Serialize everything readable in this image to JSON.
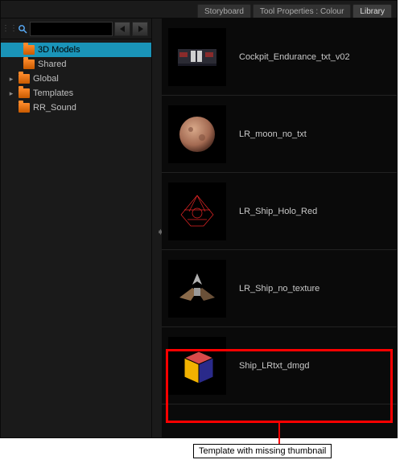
{
  "tabs": {
    "storyboard": "Storyboard",
    "tool_properties": "Tool Properties : Colour",
    "library": "Library",
    "active": "library"
  },
  "toolbar": {
    "search_value": "",
    "search_placeholder": ""
  },
  "tree": {
    "items": [
      {
        "label": "3D Models",
        "selected": true,
        "expandable": false,
        "indent": true
      },
      {
        "label": "Shared",
        "selected": false,
        "expandable": false,
        "indent": true
      },
      {
        "label": "Global",
        "selected": false,
        "expandable": true,
        "indent": false
      },
      {
        "label": "Templates",
        "selected": false,
        "expandable": true,
        "indent": false
      },
      {
        "label": "RR_Sound",
        "selected": false,
        "expandable": false,
        "indent": false
      }
    ]
  },
  "items": [
    {
      "name": "Cockpit_Endurance_txt_v02",
      "thumb": "cockpit"
    },
    {
      "name": "LR_moon_no_txt",
      "thumb": "moon"
    },
    {
      "name": "LR_Ship_Holo_Red",
      "thumb": "holo"
    },
    {
      "name": "LR_Ship_no_texture",
      "thumb": "ship"
    },
    {
      "name": "Ship_LRtxt_dmgd",
      "thumb": "cube"
    }
  ],
  "annotation": {
    "label": "Template with missing thumbnail"
  },
  "colors": {
    "selection": "#1a94b8",
    "highlight": "#ff0000"
  }
}
